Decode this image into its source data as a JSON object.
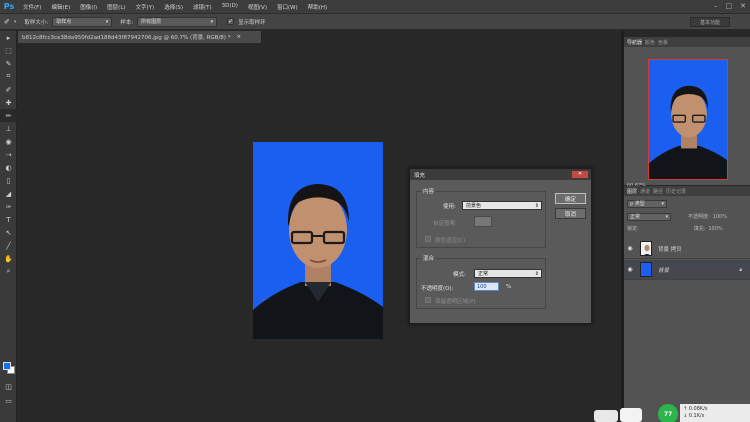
{
  "app": {
    "logo": "Ps"
  },
  "menu": [
    "文件(F)",
    "编辑(E)",
    "图像(I)",
    "图层(L)",
    "文字(Y)",
    "选择(S)",
    "滤镜(T)",
    "3D(D)",
    "视图(V)",
    "窗口(W)",
    "帮助(H)"
  ],
  "window_controls": {
    "minimize": "–",
    "maximize": "□",
    "close": "✕"
  },
  "options": {
    "sample_size_label": "取样大小:",
    "sample_size_value": "取样点",
    "sample_label": "样本:",
    "sample_value": "所有图层",
    "show_ring_label": "显示取样环",
    "show_ring_checked": "✓",
    "workspace": "基本功能"
  },
  "document": {
    "tab_title": "b812c8fcc3ce38da950fd2ad188d43f87942706.jpg @ 60.7% (背景, RGB/8) *",
    "tab_close": "×"
  },
  "tools": [
    "▸",
    "⬚",
    "✎",
    "⌗",
    "✐",
    "✚",
    "✏",
    "⊥",
    "◉",
    "⇢",
    "◐",
    "▯",
    "◢",
    "✑",
    "T",
    "↖",
    "╱",
    "✋",
    "⌕"
  ],
  "colors": {
    "foreground": "#1470f0",
    "background": "#ffffff",
    "photo_bg": "#1a5ff0"
  },
  "fill_dialog": {
    "title": "填充",
    "close": "✕",
    "content_title": "内容",
    "use_label": "使用:",
    "use_value": "前景色",
    "custom_pattern_label": "自定图案:",
    "script_label": "颜色适应(C)",
    "blend_title": "混合",
    "mode_label": "模式:",
    "mode_value": "正常",
    "opacity_label": "不透明度(O):",
    "opacity_value": "100",
    "opacity_unit": "%",
    "preserve_label": "保留透明区域(P)",
    "ok": "确定",
    "cancel": "取消"
  },
  "navigator": {
    "tabs": [
      "导航器",
      "颜色",
      "色板"
    ],
    "zoom": "60.67%"
  },
  "layers": {
    "tabs": [
      "图层",
      "通道",
      "路径",
      "历史记录"
    ],
    "filter_label": "ρ 类型",
    "blend_mode": "正常",
    "opacity_label": "不透明度:",
    "opacity_value": "100%",
    "lock_label": "锁定:",
    "fill_label": "填充:",
    "fill_value": "100%",
    "items": [
      {
        "name": "背景 拷贝",
        "selected": false
      },
      {
        "name": "背景",
        "selected": true
      }
    ]
  },
  "tray": {
    "badge": "77",
    "speed_up": "↑ 0.08K/s",
    "speed_down": "↓ 0.1K/s"
  }
}
